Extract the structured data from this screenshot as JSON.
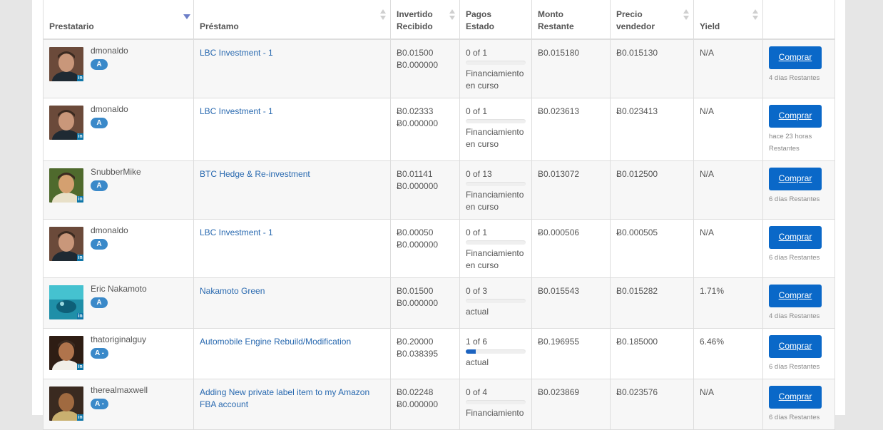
{
  "headers": {
    "borrower": "Prestatario",
    "loan": "Préstamo",
    "invested": [
      "Invertido",
      "Recibido"
    ],
    "payments": [
      "Pagos",
      "Estado"
    ],
    "remaining": [
      "Monto",
      "Restante"
    ],
    "seller_price": [
      "Precio",
      "vendedor"
    ],
    "yield": "Yield"
  },
  "buy_label": "Comprar",
  "rows": [
    {
      "borrower": "dmonaldo",
      "grade": "A",
      "avatar": "portrait-icon",
      "loan": "LBC Investment - 1",
      "invested": "Ƀ0.01500",
      "received": "Ƀ0.000000",
      "payments": "0 of 1",
      "progress": 0,
      "status": "Financiamiento en curso",
      "remaining": "Ƀ0.015180",
      "seller_price": "Ƀ0.015130",
      "yield": "N/A",
      "time_left": "4 días Restantes"
    },
    {
      "borrower": "dmonaldo",
      "grade": "A",
      "avatar": "portrait-icon",
      "loan": "LBC Investment - 1",
      "invested": "Ƀ0.02333",
      "received": "Ƀ0.000000",
      "payments": "0 of 1",
      "progress": 0,
      "status": "Financiamiento en curso",
      "remaining": "Ƀ0.023613",
      "seller_price": "Ƀ0.023413",
      "yield": "N/A",
      "time_left": "hace 23 horas Restantes"
    },
    {
      "borrower": "SnubberMike",
      "grade": "A",
      "avatar": "portrait-icon",
      "loan": "BTC Hedge & Re-investment",
      "invested": "Ƀ0.01141",
      "received": "Ƀ0.000000",
      "payments": "0 of 13",
      "progress": 0,
      "status": "Financiamiento en curso",
      "remaining": "Ƀ0.013072",
      "seller_price": "Ƀ0.012500",
      "yield": "N/A",
      "time_left": "6 días Restantes"
    },
    {
      "borrower": "dmonaldo",
      "grade": "A",
      "avatar": "portrait-icon",
      "loan": "LBC Investment - 1",
      "invested": "Ƀ0.00050",
      "received": "Ƀ0.000000",
      "payments": "0 of 1",
      "progress": 0,
      "status": "Financiamiento en curso",
      "remaining": "Ƀ0.000506",
      "seller_price": "Ƀ0.000505",
      "yield": "N/A",
      "time_left": "6 días Restantes"
    },
    {
      "borrower": "Eric Nakamoto",
      "grade": "A",
      "avatar": "underwater-image-icon",
      "loan": "Nakamoto Green",
      "invested": "Ƀ0.01500",
      "received": "Ƀ0.000000",
      "payments": "0 of 3",
      "progress": 0,
      "status": "actual",
      "remaining": "Ƀ0.015543",
      "seller_price": "Ƀ0.015282",
      "yield": "1.71%",
      "time_left": "4 días Restantes"
    },
    {
      "borrower": "thatoriginalguy",
      "grade": "A -",
      "avatar": "portrait-icon",
      "loan": "Automobile Engine Rebuild/Modification",
      "invested": "Ƀ0.20000",
      "received": "Ƀ0.038395",
      "payments": "1 of 6",
      "progress": 0.1667,
      "status": "actual",
      "remaining": "Ƀ0.196955",
      "seller_price": "Ƀ0.185000",
      "yield": "6.46%",
      "time_left": "6 días Restantes"
    },
    {
      "borrower": "therealmaxwell",
      "grade": "A -",
      "avatar": "portrait-icon",
      "loan": "Adding New private label item to my Amazon FBA account",
      "invested": "Ƀ0.02248",
      "received": "Ƀ0.000000",
      "payments": "0 of 4",
      "progress": 0,
      "status": "Financiamiento",
      "remaining": "Ƀ0.023869",
      "seller_price": "Ƀ0.023576",
      "yield": "N/A",
      "time_left": "6 días Restantes"
    }
  ],
  "colors": {
    "link": "#2a6ab0",
    "button": "#0a68c8",
    "grade_badge": "#3a89c9",
    "progress_fill": "#1c63c0",
    "sort_active": "#6d7fc8",
    "page_bg": "#e6e6e6"
  }
}
